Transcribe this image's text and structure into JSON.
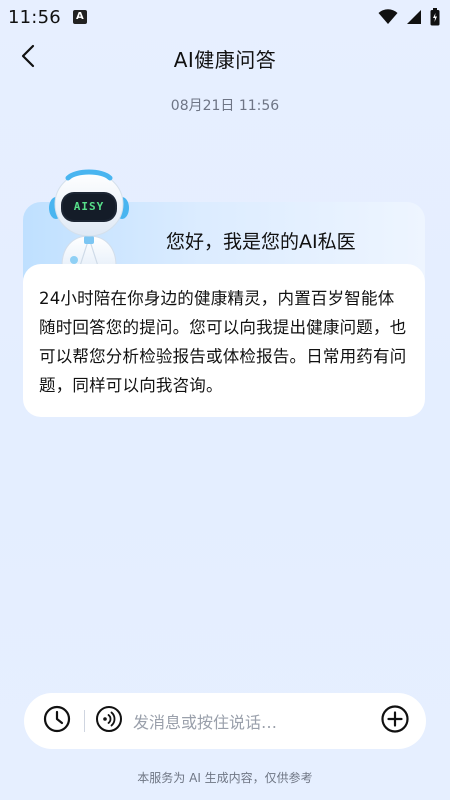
{
  "status_bar": {
    "time": "11:56",
    "app_icon_letter": "A",
    "icons": [
      "wifi-icon",
      "signal-icon",
      "battery-icon"
    ]
  },
  "header": {
    "title": "AI健康问答",
    "back_icon": "chevron-left-icon"
  },
  "chat": {
    "timestamp": "08月21日 11:56",
    "assistant_badge": "AISY",
    "greeting": "您好，我是您的AI私医",
    "message": "24小时陪在你身边的健康精灵，内置百岁智能体随时回答您的提问。您可以向我提出健康问题，也可以帮您分析检验报告或体检报告。日常用药有问题，同样可以向我咨询。"
  },
  "input_bar": {
    "placeholder": "发消息或按住说话…",
    "icons": [
      "clock-history-icon",
      "voice-icon",
      "plus-circle-icon"
    ]
  },
  "footer": {
    "note": "本服务为 AI 生成内容，仅供参考"
  },
  "colors": {
    "background": "#e6efff",
    "card_gradient_start": "#bfe0ff",
    "robot_accent": "#49b5f0",
    "badge_text": "#57e08a"
  }
}
